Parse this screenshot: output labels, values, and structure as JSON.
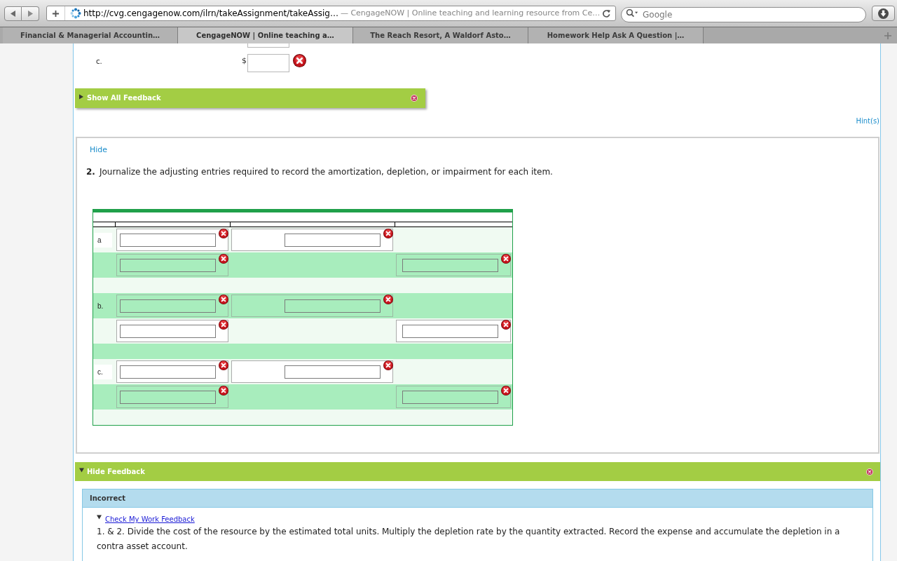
{
  "browser": {
    "url": "http://cvg.cengagenow.com/ilrn/takeAssignment/takeAssig…",
    "page_title": "— CengageNOW | Online teaching and learning resource from Ce…",
    "search": {
      "placeholder": "Google"
    }
  },
  "tabs": [
    {
      "label": "Financial & Managerial Accountin…",
      "selected": false
    },
    {
      "label": "CengageNOW | Online teaching a…",
      "selected": true
    },
    {
      "label": "The Reach Resort, A Waldorf Asto…",
      "selected": false
    },
    {
      "label": "Homework Help Ask A Question |…",
      "selected": false
    }
  ],
  "part_1": {
    "rows": [
      {
        "label": "c.",
        "prefix": "$",
        "incorrect": true
      }
    ]
  },
  "show_all_feedback": {
    "label": "Show All Feedback",
    "expanded": false
  },
  "hint_link": "Hint(s)",
  "question": {
    "hide_link": "Hide",
    "number": "2.",
    "text": "Journalize the adjusting entries required to record the amortization, depletion, or impairment for each item.",
    "journal": {
      "rows": [
        {
          "kind": "entry",
          "label": "a",
          "column_2": {
            "incorrect": true
          },
          "column_3": {
            "incorrect": true
          }
        },
        {
          "kind": "entry",
          "column_2": {
            "incorrect": true
          },
          "column_4": {
            "incorrect": true
          }
        },
        {
          "kind": "spacer"
        },
        {
          "kind": "entry",
          "label": "b.",
          "column_2": {
            "incorrect": true
          },
          "column_3": {
            "incorrect": true
          }
        },
        {
          "kind": "entry",
          "column_2": {
            "incorrect": true
          },
          "column_4": {
            "incorrect": true
          }
        },
        {
          "kind": "spacer"
        },
        {
          "kind": "entry",
          "label": "c.",
          "column_2": {
            "incorrect": true
          },
          "column_3": {
            "incorrect": true
          }
        },
        {
          "kind": "entry",
          "column_2": {
            "incorrect": true
          },
          "column_4": {
            "incorrect": true
          }
        },
        {
          "kind": "spacer"
        }
      ]
    }
  },
  "feedback": {
    "label": "Hide Feedback",
    "expanded": true,
    "result": "Incorrect",
    "link": {
      "label": "Check My Work Feedback",
      "expanded": true
    },
    "text": [
      "1. & 2. Divide the cost of the resource by the estimated total units. Multiply the depletion rate by the quantity extracted. Record the expense and accumulate the depletion in a contra asset account."
    ]
  }
}
